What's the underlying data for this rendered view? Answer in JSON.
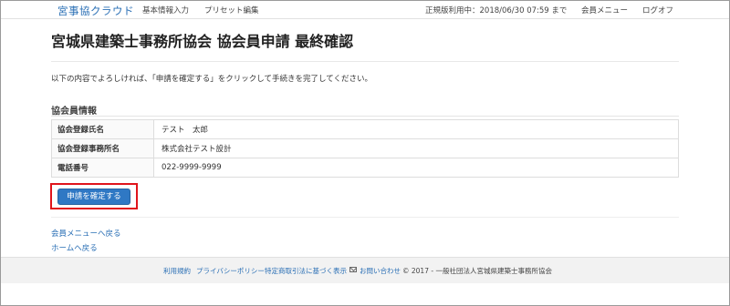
{
  "navbar": {
    "brand": "宮事協クラウド",
    "items": [
      "基本情報入力",
      "プリセット編集"
    ],
    "status": "正規版利用中：2018/06/30 07:59 まで",
    "member_menu": "会員メニュー",
    "logout": "ログオフ"
  },
  "page": {
    "title": "宮城県建築士事務所協会 協会員申請 最終確認",
    "intro": "以下の内容でよろしければ、「申請を確定する」をクリックして手続きを完了してください。",
    "section_title": "協会員情報",
    "rows": [
      {
        "label": "協会登録氏名",
        "value": "テスト　太郎"
      },
      {
        "label": "協会登録事務所名",
        "value": "株式会社テスト設計"
      },
      {
        "label": "電話番号",
        "value": "022-9999-9999"
      }
    ],
    "confirm_button": "申請を確定する",
    "back_member_menu": "会員メニューへ戻る",
    "back_home": "ホームへ戻る"
  },
  "footer": {
    "terms": "利用規約",
    "privacy": "プライバシーポリシー",
    "tokutei": "特定商取引法に基づく表示",
    "contact": "お問い合わせ",
    "copyright": "© 2017 - 一般社団法人宮城県建築士事務所協会"
  },
  "colors": {
    "brand": "#2a6fb5",
    "button": "#2f78c4",
    "highlight": "#e0141b"
  },
  "icons": {
    "contact": "mail-icon"
  }
}
